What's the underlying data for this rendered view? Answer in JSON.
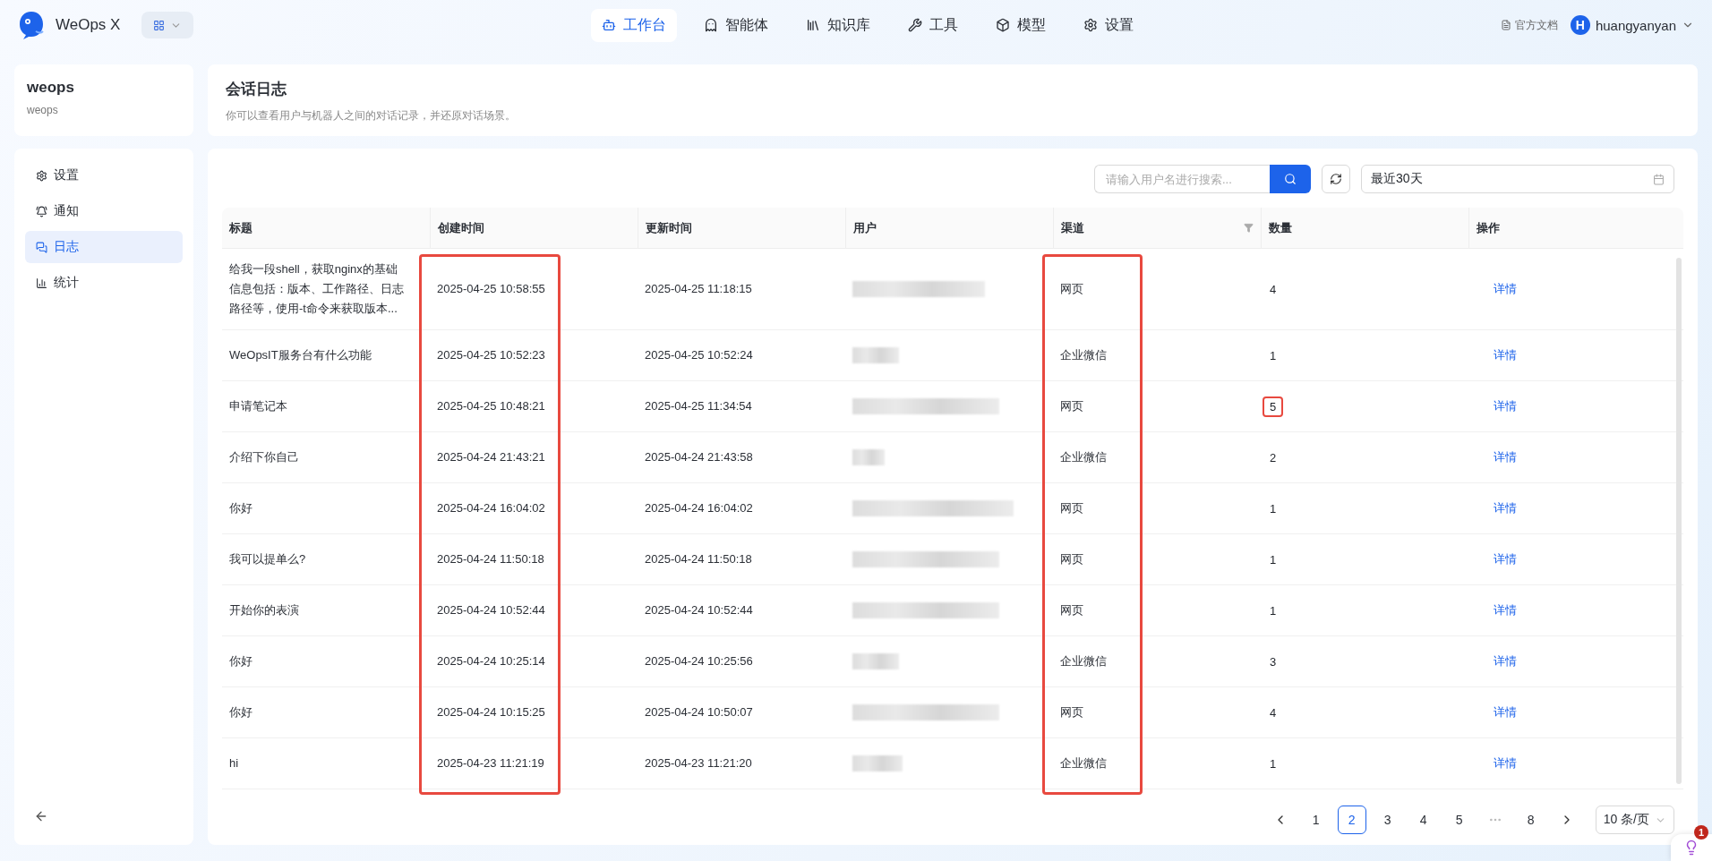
{
  "app": {
    "name": "WeOps X"
  },
  "nav": [
    {
      "label": "工作台",
      "selected": true
    },
    {
      "label": "智能体",
      "selected": false
    },
    {
      "label": "知识库",
      "selected": false
    },
    {
      "label": "工具",
      "selected": false
    },
    {
      "label": "模型",
      "selected": false
    },
    {
      "label": "设置",
      "selected": false
    }
  ],
  "user_menu": {
    "docs": "官方文档",
    "avatar": "H",
    "name": "huangyanyan"
  },
  "sidebar": {
    "title": "weops",
    "subtitle": "weops",
    "items": [
      {
        "label": "设置",
        "selected": false
      },
      {
        "label": "通知",
        "selected": false
      },
      {
        "label": "日志",
        "selected": true
      },
      {
        "label": "统计",
        "selected": false
      }
    ]
  },
  "page": {
    "title": "会话日志",
    "description": "你可以查看用户与机器人之间的对话记录，并还原对话场景。"
  },
  "toolbar": {
    "search_placeholder": "请输入用户名进行搜索...",
    "date_range": "最近30天"
  },
  "table": {
    "columns": [
      {
        "label": "标题",
        "annotated": false,
        "filter": false
      },
      {
        "label": "创建时间",
        "annotated": true,
        "filter": false
      },
      {
        "label": "更新时间",
        "annotated": false,
        "filter": false
      },
      {
        "label": "用户",
        "annotated": false,
        "filter": false
      },
      {
        "label": "渠道",
        "annotated": true,
        "filter": true
      },
      {
        "label": "数量",
        "annotated": false,
        "filter": false
      },
      {
        "label": "操作",
        "annotated": false,
        "filter": false
      }
    ],
    "rows": [
      {
        "title": "给我一段shell，获取nginx的基础信息包括：版本、工作路径、日志路径等，使用-t命令来获取版本...",
        "created": "2025-04-25 10:58:55",
        "updated": "2025-04-25 11:18:15",
        "channel": "网页",
        "count": "4",
        "count_annotated": false,
        "action": "详情"
      },
      {
        "title": "WeOpsIT服务台有什么功能",
        "created": "2025-04-25 10:52:23",
        "updated": "2025-04-25 10:52:24",
        "channel": "企业微信",
        "count": "1",
        "count_annotated": false,
        "action": "详情"
      },
      {
        "title": "申请笔记本",
        "created": "2025-04-25 10:48:21",
        "updated": "2025-04-25 11:34:54",
        "channel": "网页",
        "count": "5",
        "count_annotated": true,
        "action": "详情"
      },
      {
        "title": "介绍下你自己",
        "created": "2025-04-24 21:43:21",
        "updated": "2025-04-24 21:43:58",
        "channel": "企业微信",
        "count": "2",
        "count_annotated": false,
        "action": "详情"
      },
      {
        "title": "你好",
        "created": "2025-04-24 16:04:02",
        "updated": "2025-04-24 16:04:02",
        "channel": "网页",
        "count": "1",
        "count_annotated": false,
        "action": "详情"
      },
      {
        "title": "我可以提单么?",
        "created": "2025-04-24 11:50:18",
        "updated": "2025-04-24 11:50:18",
        "channel": "网页",
        "count": "1",
        "count_annotated": false,
        "action": "详情"
      },
      {
        "title": "开始你的表演",
        "created": "2025-04-24 10:52:44",
        "updated": "2025-04-24 10:52:44",
        "channel": "网页",
        "count": "1",
        "count_annotated": false,
        "action": "详情"
      },
      {
        "title": "你好",
        "created": "2025-04-24 10:25:14",
        "updated": "2025-04-24 10:25:56",
        "channel": "企业微信",
        "count": "3",
        "count_annotated": false,
        "action": "详情"
      },
      {
        "title": "你好",
        "created": "2025-04-24 10:15:25",
        "updated": "2025-04-24 10:50:07",
        "channel": "网页",
        "count": "4",
        "count_annotated": false,
        "action": "详情"
      },
      {
        "title": "hi",
        "created": "2025-04-23 11:21:19",
        "updated": "2025-04-23 11:21:20",
        "channel": "企业微信",
        "count": "1",
        "count_annotated": false,
        "action": "详情"
      }
    ]
  },
  "pagination": {
    "pages": [
      {
        "label": "1",
        "selected": false
      },
      {
        "label": "2",
        "selected": true
      },
      {
        "label": "3",
        "selected": false
      },
      {
        "label": "4",
        "selected": false
      },
      {
        "label": "5",
        "selected": false
      },
      {
        "label": "8",
        "selected": false
      }
    ],
    "page_size": "10 条/页"
  },
  "assistant": {
    "badge": "1"
  }
}
